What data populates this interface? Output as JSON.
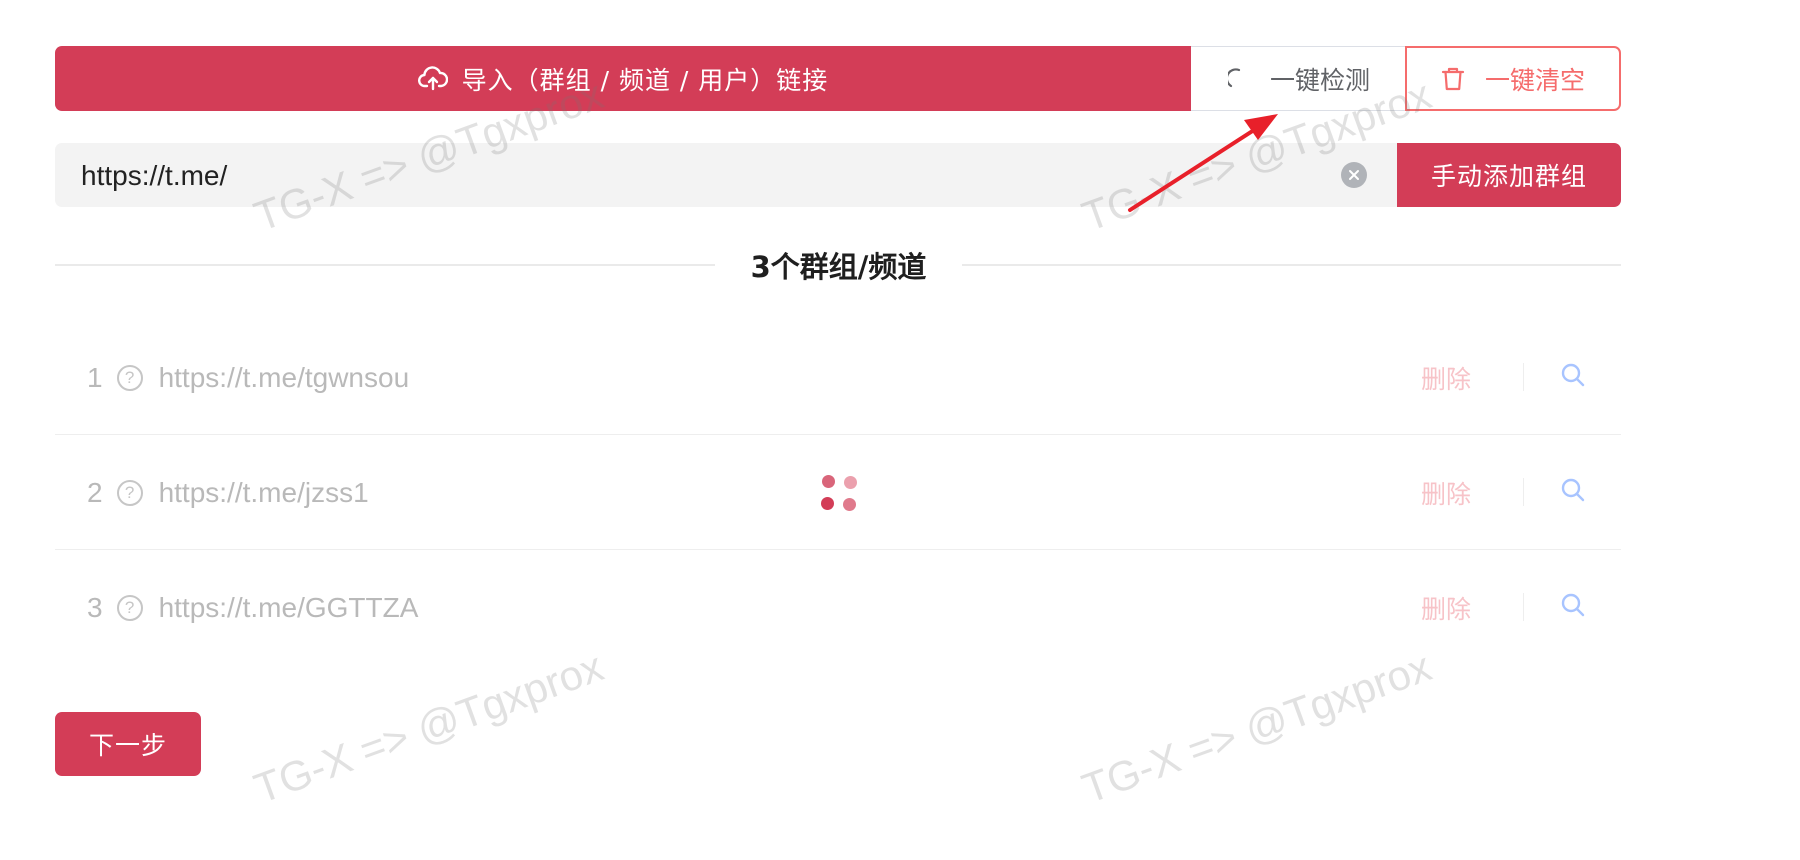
{
  "toolbar": {
    "import_label": "导入（群组 / 频道 / 用户）链接",
    "import_icon": "cloud-upload-icon",
    "detect_label": "一键检测",
    "detect_icon": "loading-spinner-icon",
    "clear_label": "一键清空",
    "clear_icon": "trash-icon"
  },
  "url_input": {
    "value": "https://t.me/",
    "clear_icon": "clear-circle-icon"
  },
  "add_button": {
    "label": "手动添加群组"
  },
  "divider": {
    "title": "3个群组/频道"
  },
  "list": {
    "items": [
      {
        "index": "1",
        "url": "https://t.me/tgwnsou",
        "delete_label": "删除"
      },
      {
        "index": "2",
        "url": "https://t.me/jzss1",
        "delete_label": "删除"
      },
      {
        "index": "3",
        "url": "https://t.me/GGTTZA",
        "delete_label": "删除"
      }
    ],
    "status_icon": "question-circle-icon",
    "search_icon": "search-icon"
  },
  "next_button": {
    "label": "下一步"
  },
  "watermark": {
    "text": "TG-X => @Tgxprox"
  },
  "colors": {
    "primary": "#d33d57",
    "danger": "#f56c6c",
    "link_search": "#a8c4ff",
    "muted_text": "#b9b9b9",
    "annotation_arrow": "#e8202a"
  }
}
